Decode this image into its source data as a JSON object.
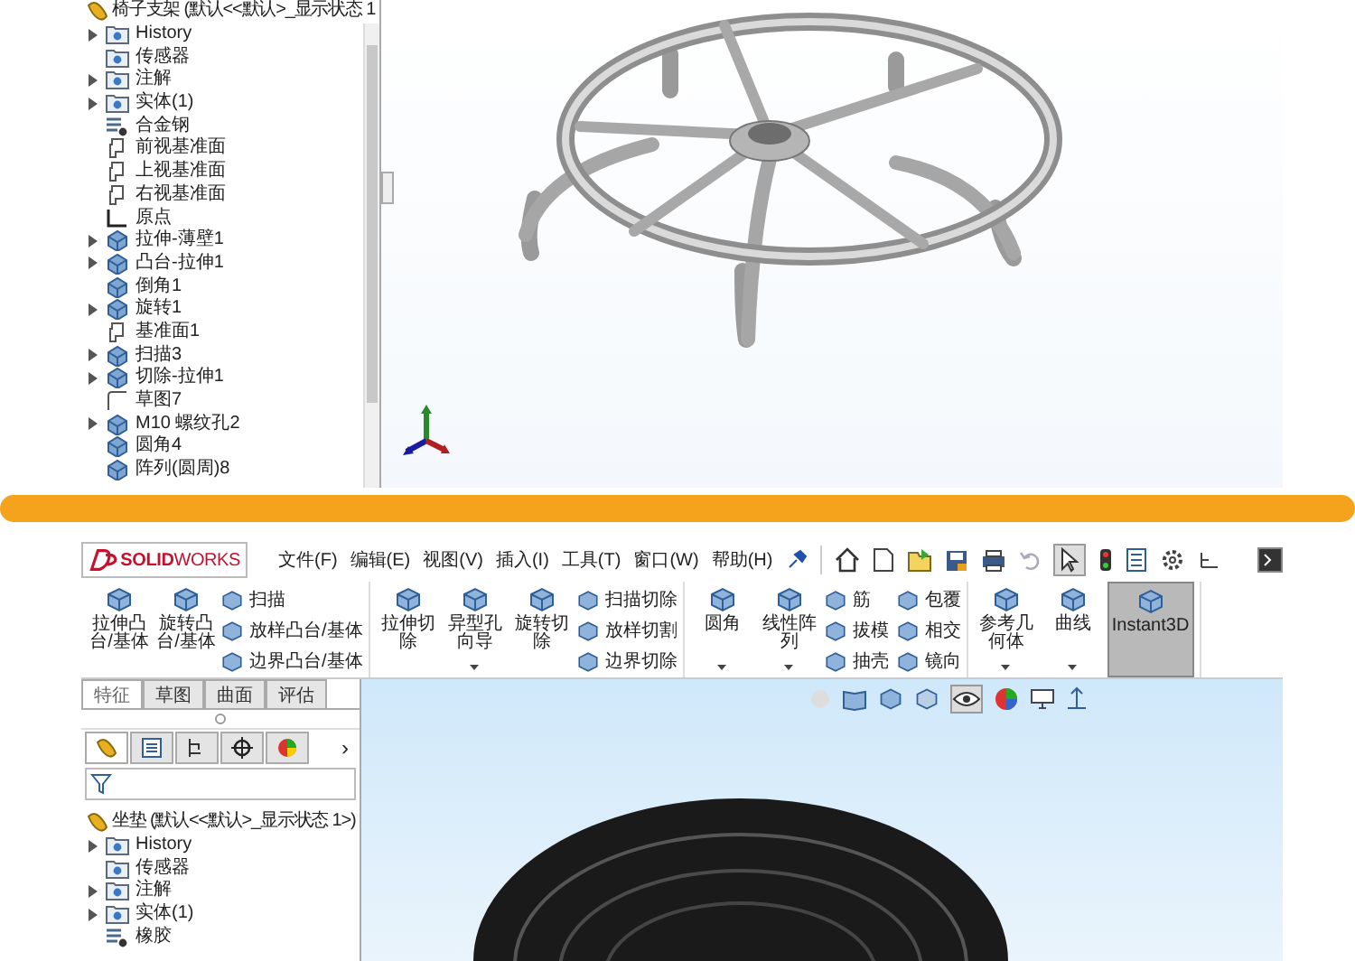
{
  "top_window": {
    "feature_tree": {
      "root": "椅子支架 (默认<<默认>_显示状态 1",
      "items": [
        {
          "label": "History",
          "kind": "folder",
          "expandable": true
        },
        {
          "label": "传感器",
          "kind": "folder",
          "expandable": false
        },
        {
          "label": "注解",
          "kind": "folder",
          "expandable": true
        },
        {
          "label": "实体(1)",
          "kind": "folder",
          "expandable": true
        },
        {
          "label": "合金钢",
          "kind": "material",
          "expandable": false
        },
        {
          "label": "前视基准面",
          "kind": "plane",
          "expandable": false
        },
        {
          "label": "上视基准面",
          "kind": "plane",
          "expandable": false
        },
        {
          "label": "右视基准面",
          "kind": "plane",
          "expandable": false
        },
        {
          "label": "原点",
          "kind": "origin",
          "expandable": false
        },
        {
          "label": "拉伸-薄壁1",
          "kind": "solid",
          "expandable": true
        },
        {
          "label": "凸台-拉伸1",
          "kind": "solid",
          "expandable": true
        },
        {
          "label": "倒角1",
          "kind": "solid",
          "expandable": false
        },
        {
          "label": "旋转1",
          "kind": "solid",
          "expandable": true
        },
        {
          "label": "基准面1",
          "kind": "plane",
          "expandable": false
        },
        {
          "label": "扫描3",
          "kind": "solid",
          "expandable": true
        },
        {
          "label": "切除-拉伸1",
          "kind": "solid",
          "expandable": true
        },
        {
          "label": "草图7",
          "kind": "sketch",
          "expandable": false
        },
        {
          "label": "M10 螺纹孔2",
          "kind": "solid",
          "expandable": true
        },
        {
          "label": "圆角4",
          "kind": "solid",
          "expandable": false
        },
        {
          "label": "阵列(圆周)8",
          "kind": "solid",
          "expandable": false
        }
      ]
    }
  },
  "bottom_window": {
    "logo": "**SOLID**WORKS",
    "menu": [
      "文件(F)",
      "编辑(E)",
      "视图(V)",
      "插入(I)",
      "工具(T)",
      "窗口(W)",
      "帮助(H)"
    ],
    "ribbon": {
      "groups": [
        {
          "large": [
            {
              "label": "拉伸凸台/基体",
              "dropdown": false,
              "selected": false
            },
            {
              "label": "旋转凸台/基体",
              "dropdown": false,
              "selected": false
            }
          ],
          "small": [
            "扫描",
            "放样凸台/基体",
            "边界凸台/基体"
          ]
        },
        {
          "large": [
            {
              "label": "拉伸切除",
              "dropdown": false,
              "selected": false
            },
            {
              "label": "异型孔向导",
              "dropdown": true,
              "selected": false
            },
            {
              "label": "旋转切除",
              "dropdown": false,
              "selected": false
            }
          ],
          "small": [
            "扫描切除",
            "放样切割",
            "边界切除"
          ]
        },
        {
          "large": [
            {
              "label": "圆角",
              "dropdown": true,
              "selected": false
            },
            {
              "label": "线性阵列",
              "dropdown": true,
              "selected": false
            }
          ],
          "small": [
            "筋",
            "拔模",
            "抽壳",
            "包覆",
            "相交",
            "镜向"
          ]
        },
        {
          "large": [
            {
              "label": "参考几何体",
              "dropdown": true,
              "selected": false
            },
            {
              "label": "曲线",
              "dropdown": true,
              "selected": false
            },
            {
              "label": "Instant3D",
              "dropdown": false,
              "selected": true
            }
          ]
        }
      ]
    },
    "command_tabs": [
      {
        "label": "特征",
        "selected": true
      },
      {
        "label": "草图",
        "selected": false
      },
      {
        "label": "曲面",
        "selected": false
      },
      {
        "label": "评估",
        "selected": false
      }
    ],
    "panel_tabs": [
      {
        "kind": "part",
        "selected": true
      },
      {
        "kind": "list",
        "selected": false
      },
      {
        "kind": "config",
        "selected": false
      },
      {
        "kind": "target",
        "selected": false
      },
      {
        "kind": "color",
        "selected": false
      }
    ],
    "panel_tabs_more": "›",
    "feature_tree": {
      "root": "坐垫 (默认<<默认>_显示状态 1>)",
      "items": [
        {
          "label": "History",
          "kind": "folder",
          "expandable": true
        },
        {
          "label": "传感器",
          "kind": "folder",
          "expandable": false
        },
        {
          "label": "注解",
          "kind": "folder",
          "expandable": true
        },
        {
          "label": "实体(1)",
          "kind": "folder",
          "expandable": true
        },
        {
          "label": "橡胶",
          "kind": "material",
          "expandable": false
        }
      ]
    }
  }
}
